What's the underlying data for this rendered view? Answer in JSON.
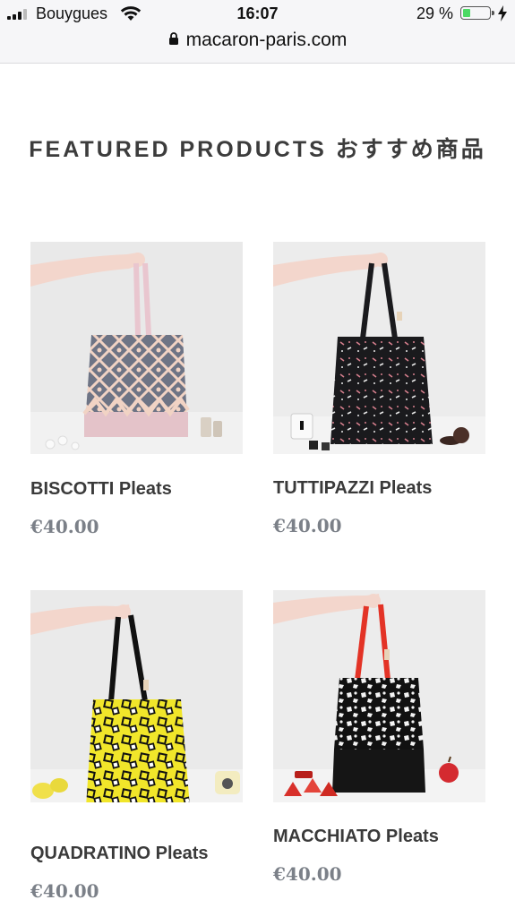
{
  "status_bar": {
    "carrier": "Bouygues",
    "time": "16:07",
    "battery_percent": "29 %",
    "battery_level": 0.29
  },
  "address_bar": {
    "url": "macaron-paris.com"
  },
  "section": {
    "title": "FEATURED PRODUCTS おすすめ商品"
  },
  "products": [
    {
      "name": "BISCOTTI Pleats",
      "price": "€40.00"
    },
    {
      "name": "TUTTIPAZZI Pleats",
      "price": "€40.00"
    },
    {
      "name": "QUADRATINO Pleats",
      "price": "€40.00"
    },
    {
      "name": "MACCHIATO Pleats",
      "price": "€40.00"
    }
  ],
  "colors": {
    "biscotti_handle": "#e9c6cf",
    "biscotti_bag": "#6e7485",
    "tuttipazzi_bag": "#1a1a1d",
    "quadratino_bag": "#f1e62a",
    "macchiato_handle": "#e33326",
    "macchiato_bag": "#111111"
  }
}
